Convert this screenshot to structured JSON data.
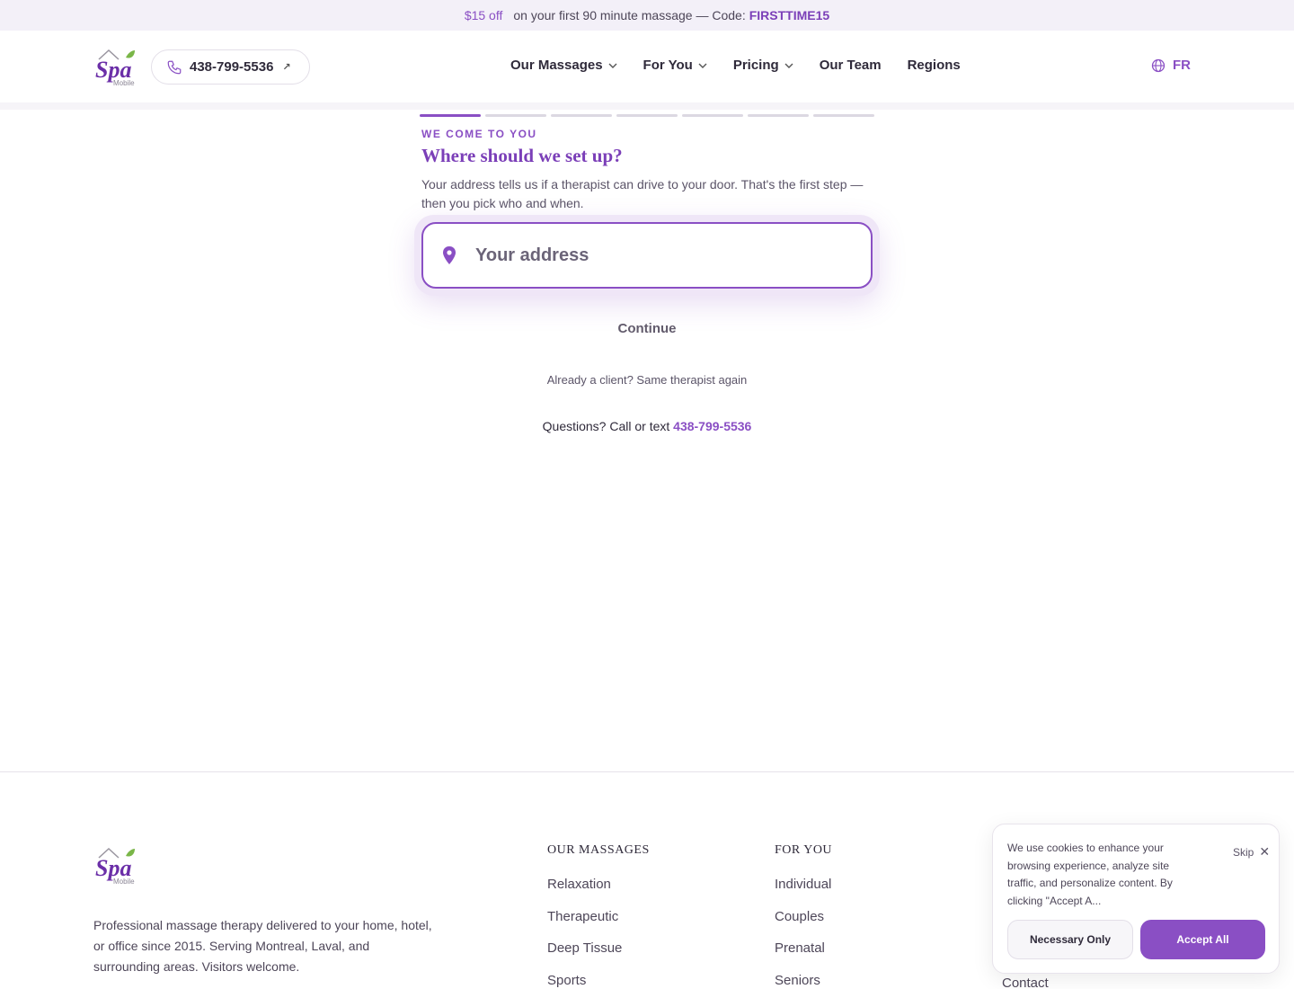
{
  "promo": {
    "amount": "$15 off",
    "text": "on your first 90 minute massage — Code:",
    "code": "FIRSTTIME15"
  },
  "header": {
    "logo_text": "Spa",
    "logo_sub": "Mobile",
    "phone": "438-799-5536",
    "nav": [
      {
        "label": "Our Massages",
        "dropdown": true
      },
      {
        "label": "For You",
        "dropdown": true
      },
      {
        "label": "Pricing",
        "dropdown": true
      },
      {
        "label": "Our Team",
        "dropdown": false
      },
      {
        "label": "Regions",
        "dropdown": false
      }
    ],
    "language": "FR"
  },
  "step": {
    "total_steps": 7,
    "current_step": 1,
    "eyebrow": "WE COME TO YOU",
    "heading": "Where should we set up?",
    "lede": "Your address tells us if a therapist can drive to your door. That's the first step — then you pick who and when.",
    "address_placeholder": "Your address",
    "continue_label": "Continue",
    "client_link": "Already a client? Same therapist again",
    "questions_text": "Questions? Call or text",
    "questions_phone": "438-799-5536"
  },
  "footer": {
    "description": "Professional massage therapy delivered to your home, hotel, or office since 2015. Serving Montreal, Laval, and surrounding areas. Visitors welcome.",
    "columns": [
      {
        "title": "OUR MASSAGES",
        "links": [
          "Relaxation",
          "Therapeutic",
          "Deep Tissue",
          "Sports"
        ]
      },
      {
        "title": "FOR YOU",
        "links": [
          "Individual",
          "Couples",
          "Prenatal",
          "Seniors"
        ]
      }
    ],
    "partial_link": "Contact"
  },
  "cookie": {
    "text": "We use cookies to enhance your browsing experience, analyze site traffic, and personalize content. By clicking \"Accept A...",
    "skip_label": "Skip",
    "necessary_label": "Necessary Only",
    "accept_label": "Accept All"
  },
  "colors": {
    "accent": "#8a4fc4",
    "accent_dark": "#7b3fb8",
    "promo_bg": "#f3f0f8",
    "text": "#2f2a3a"
  }
}
